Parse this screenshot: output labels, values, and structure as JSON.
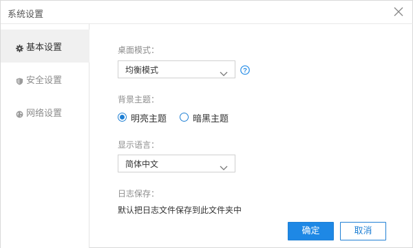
{
  "window": {
    "title": "系统设置",
    "close_icon": "close-icon"
  },
  "sidebar": {
    "items": [
      {
        "label": "基本设置",
        "icon": "gear-icon",
        "active": true
      },
      {
        "label": "安全设置",
        "icon": "shield-icon",
        "active": false
      },
      {
        "label": "网络设置",
        "icon": "globe-icon",
        "active": false
      }
    ]
  },
  "settings": {
    "desktop_mode": {
      "label": "桌面模式：",
      "value": "均衡模式",
      "help_icon": "help-icon"
    },
    "theme": {
      "label": "背景主题：",
      "options": [
        {
          "label": "明亮主题",
          "checked": true
        },
        {
          "label": "暗黑主题",
          "checked": false
        }
      ]
    },
    "language": {
      "label": "显示语言：",
      "value": "简体中文"
    },
    "log": {
      "label": "日志保存：",
      "text": "默认把日志文件保存到此文件夹中"
    }
  },
  "buttons": {
    "ok": "确定",
    "cancel": "取消"
  },
  "colors": {
    "accent": "#1e88e5",
    "accent_border": "#1e7fd4",
    "active_nav_bg": "#f0f0f0"
  }
}
